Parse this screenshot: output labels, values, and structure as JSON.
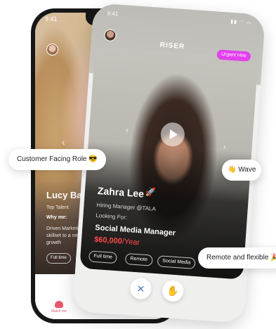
{
  "back_phone": {
    "time": "9:41",
    "name": "Lucy Barnes",
    "subtitle": "Top Talent",
    "why_label": "Why me:",
    "description": "Driven Marketing skillset to a new to growth",
    "tags": [
      "Full time",
      ""
    ],
    "nav": {
      "active_label": "Match me",
      "other_labels": [
        "",
        ""
      ]
    }
  },
  "front_phone": {
    "time": "9:41",
    "logo": "RISER",
    "urgent_badge": "Urgent Hire",
    "candidate_name": "Zahra Lee",
    "name_emoji": "🚀",
    "role": "Hiring Manager @TALA",
    "looking_label": "Looking For:",
    "position": "Social Media Manager",
    "salary_amount": "$60,000",
    "salary_period": "/Year",
    "tags": [
      "Full time",
      "Remote",
      "Social Media"
    ],
    "actions": {
      "reject_icon": "close-icon",
      "wave_icon": "wave-hand-icon"
    }
  },
  "callouts": {
    "customer_facing": "Customer Facing Role 😎",
    "wave": "👋 Wave",
    "remote": "Remote and flexible 🎉"
  },
  "colors": {
    "accent_pink": "#e23ff0",
    "salary_red": "#ff4a4a",
    "nav_active": "#e8576b"
  }
}
